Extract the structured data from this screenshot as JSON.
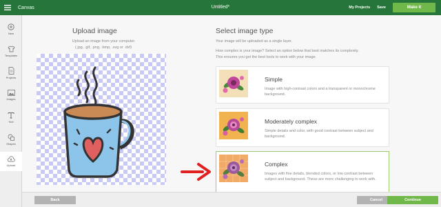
{
  "topbar": {
    "app_title": "Canvas",
    "doc_title": "Untitled*",
    "my_projects": "My Projects",
    "save": "Save",
    "make_it": "Make it",
    "bg_color": "#26753a",
    "accent_color": "#71b84a"
  },
  "sidebar": {
    "items": [
      {
        "label": "New",
        "icon": "plus-circle-icon"
      },
      {
        "label": "Templates",
        "icon": "tshirt-icon"
      },
      {
        "label": "Projects",
        "icon": "document-icon"
      },
      {
        "label": "Images",
        "icon": "image-icon"
      },
      {
        "label": "Text",
        "icon": "text-icon"
      },
      {
        "label": "Shapes",
        "icon": "shapes-icon"
      },
      {
        "label": "Upload",
        "icon": "upload-cloud-icon",
        "active": true
      }
    ]
  },
  "upload": {
    "title": "Upload image",
    "subtitle": "Upload an image from your computer",
    "formats": "(.jpg, .gif, .png, .bmp, .svg or .dxf)"
  },
  "select": {
    "title": "Select image type",
    "subtitle": "Your image will be uploaded as a single layer.",
    "desc_line1": "How complex is your image? Select an option below that best matches its complexity.",
    "desc_line2": "This ensures you get the best tools to work with your image.",
    "options": [
      {
        "title": "Simple",
        "desc": "Image with high-contrast colors and a transparent or monochrome background.",
        "thumb_bg": "#f3dfb8",
        "selected": false
      },
      {
        "title": "Moderately complex",
        "desc": "Simple details and color, with good contrast between subject and background.",
        "thumb_bg": "#f0b34f",
        "selected": false
      },
      {
        "title": "Complex",
        "desc": "Images with fine details, blended colors, or low contrast between subject and background. These are more challenging to work with.",
        "thumb_bg": "#f2ab66",
        "selected": true
      }
    ]
  },
  "bottom": {
    "back": "Back",
    "cancel": "Cancel",
    "continue": "Continue"
  }
}
